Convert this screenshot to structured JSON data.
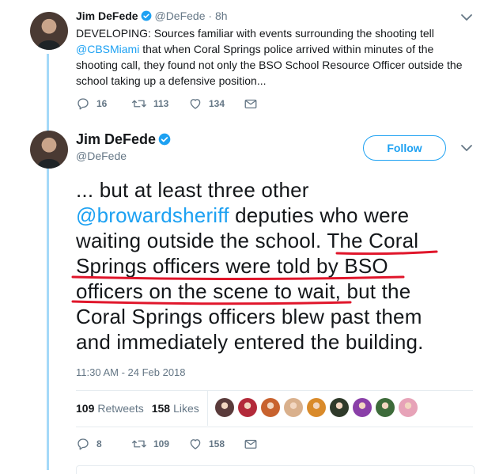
{
  "tweet1": {
    "author_name": "Jim DeFede",
    "handle": "@DeFede",
    "separator": "·",
    "time": "8h",
    "text_before": "DEVELOPING: Sources familiar with events surrounding the shooting tell ",
    "mention": "@CBSMiami",
    "text_after": " that when Coral Springs police arrived within minutes of the shooting call, they found not only the BSO School Resource Officer outside the school taking up a defensive position...",
    "replies": "16",
    "retweets": "113",
    "likes": "134"
  },
  "tweet2": {
    "author_name": "Jim DeFede",
    "handle": "@DeFede",
    "follow_label": "Follow",
    "text_before": "... but at least three other ",
    "mention": "@browardsheriff",
    "text_middle": " deputies who were waiting outside the school. ",
    "text_underlined": "The Coral Springs officers were told by BSO officers on the scene to wait,",
    "text_after": " but the Coral Springs officers blew past them and immediately entered the building.",
    "timestamp": "11:30 AM - 24 Feb 2018",
    "retweets_count": "109",
    "retweets_label": "Retweets",
    "likes_count": "158",
    "likes_label": "Likes",
    "replies": "8",
    "retweets": "109",
    "likes": "158",
    "liker_colors": [
      "#5a3b3b",
      "#b32a3a",
      "#c8622e",
      "#d9b08c",
      "#d98a2a",
      "#2f3a2a",
      "#8a3fa8",
      "#3d6b3a",
      "#e7a3b8"
    ]
  },
  "colors": {
    "accent": "#1da1f2",
    "thread_line": "#a4d9f8",
    "underline": "#e0162b",
    "muted": "#657786"
  },
  "icons": {
    "verified": "verified-badge-icon",
    "reply": "reply-icon",
    "retweet": "retweet-icon",
    "like": "heart-icon",
    "dm": "envelope-icon",
    "caret": "chevron-down-icon"
  }
}
